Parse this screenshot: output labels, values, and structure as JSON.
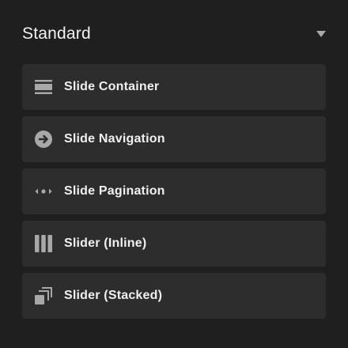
{
  "section": {
    "title": "Standard"
  },
  "items": [
    {
      "label": "Slide Container",
      "icon": "slide-container-icon"
    },
    {
      "label": "Slide Navigation",
      "icon": "arrow-right-circle-icon"
    },
    {
      "label": "Slide Pagination",
      "icon": "pagination-dots-icon"
    },
    {
      "label": "Slider (Inline)",
      "icon": "columns-icon"
    },
    {
      "label": "Slider (Stacked)",
      "icon": "stacked-squares-icon"
    }
  ],
  "colors": {
    "background": "#1f1f1f",
    "item_background": "#2d2d2d",
    "text": "#f0f0f0",
    "icon": "#a8a8a8"
  }
}
